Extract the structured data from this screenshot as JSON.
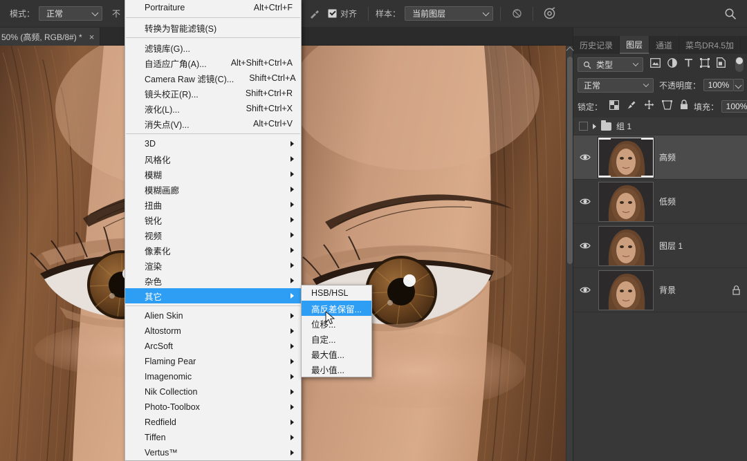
{
  "app": "Adobe Photoshop",
  "options_bar": {
    "mode_label": "模式：",
    "mode_value": "正常",
    "opacity_label_partial": "不",
    "aligned_label": "对齐",
    "sample_label": "样本：",
    "sample_value": "当前图层",
    "icons": [
      "brush-cursor-icon",
      "ignore-adjustment-layers-icon",
      "airbrush-target-icon"
    ],
    "search_icon": "search-icon"
  },
  "document_tab": {
    "title": "50% (高频, RGB/8#) *",
    "dirty_marker": "*",
    "close_icon": "×"
  },
  "filter_menu": {
    "groups": [
      {
        "items": [
          {
            "label": "Portraiture",
            "shortcut": "Alt+Ctrl+F",
            "submenu": false
          }
        ]
      },
      {
        "items": [
          {
            "label": "转换为智能滤镜(S)",
            "shortcut": "",
            "submenu": false
          }
        ]
      },
      {
        "items": [
          {
            "label": "滤镜库(G)...",
            "shortcut": "",
            "submenu": false
          },
          {
            "label": "自适应广角(A)...",
            "shortcut": "Alt+Shift+Ctrl+A",
            "submenu": false
          },
          {
            "label": "Camera Raw 滤镜(C)...",
            "shortcut": "Shift+Ctrl+A",
            "submenu": false
          },
          {
            "label": "镜头校正(R)...",
            "shortcut": "Shift+Ctrl+R",
            "submenu": false
          },
          {
            "label": "液化(L)...",
            "shortcut": "Shift+Ctrl+X",
            "submenu": false
          },
          {
            "label": "消失点(V)...",
            "shortcut": "Alt+Ctrl+V",
            "submenu": false
          }
        ]
      },
      {
        "items": [
          {
            "label": "3D",
            "shortcut": "",
            "submenu": true
          },
          {
            "label": "风格化",
            "shortcut": "",
            "submenu": true
          },
          {
            "label": "模糊",
            "shortcut": "",
            "submenu": true
          },
          {
            "label": "模糊画廊",
            "shortcut": "",
            "submenu": true
          },
          {
            "label": "扭曲",
            "shortcut": "",
            "submenu": true
          },
          {
            "label": "锐化",
            "shortcut": "",
            "submenu": true
          },
          {
            "label": "视频",
            "shortcut": "",
            "submenu": true
          },
          {
            "label": "像素化",
            "shortcut": "",
            "submenu": true
          },
          {
            "label": "渲染",
            "shortcut": "",
            "submenu": true
          },
          {
            "label": "杂色",
            "shortcut": "",
            "submenu": true
          },
          {
            "label": "其它",
            "shortcut": "",
            "submenu": true,
            "highlighted": true
          }
        ]
      },
      {
        "items": [
          {
            "label": "Alien Skin",
            "shortcut": "",
            "submenu": true
          },
          {
            "label": "Altostorm",
            "shortcut": "",
            "submenu": true
          },
          {
            "label": "ArcSoft",
            "shortcut": "",
            "submenu": true
          },
          {
            "label": "Flaming Pear",
            "shortcut": "",
            "submenu": true
          },
          {
            "label": "Imagenomic",
            "shortcut": "",
            "submenu": true
          },
          {
            "label": "Nik Collection",
            "shortcut": "",
            "submenu": true
          },
          {
            "label": "Photo-Toolbox",
            "shortcut": "",
            "submenu": true
          },
          {
            "label": "Redfield",
            "shortcut": "",
            "submenu": true
          },
          {
            "label": "Tiffen",
            "shortcut": "",
            "submenu": true
          },
          {
            "label": "Vertus™",
            "shortcut": "",
            "submenu": true
          }
        ]
      }
    ]
  },
  "other_submenu": {
    "items": [
      {
        "label": "HSB/HSL",
        "highlighted": false
      },
      {
        "label": "高反差保留...",
        "highlighted": true
      },
      {
        "label": "位移...",
        "highlighted": false
      },
      {
        "label": "自定...",
        "highlighted": false
      },
      {
        "label": "最大值...",
        "highlighted": false
      },
      {
        "label": "最小值...",
        "highlighted": false
      }
    ]
  },
  "right_panel": {
    "tabs": [
      {
        "label": "历史记录",
        "active": false
      },
      {
        "label": "图层",
        "active": true
      },
      {
        "label": "通道",
        "active": false
      },
      {
        "label": "菜鸟DR4.5加",
        "active": false
      }
    ],
    "panel_menu_icon": "hamburger-icon",
    "filter": {
      "kind_value": "类型",
      "search_icon": "search-icon",
      "icons": [
        "pixel-layer-filter-icon",
        "adjustment-layer-filter-icon",
        "type-layer-filter-icon",
        "shape-layer-filter-icon",
        "smart-object-filter-icon"
      ],
      "toggle": "filter-enable-toggle"
    },
    "blend": {
      "mode_value": "正常",
      "opacity_label": "不透明度：",
      "opacity_value": "100%"
    },
    "lock": {
      "label": "锁定：",
      "icons": [
        "lock-transparency-icon",
        "lock-image-icon",
        "lock-position-icon",
        "lock-artboard-icon",
        "lock-all-icon"
      ],
      "fill_label": "填充：",
      "fill_value": "100%"
    },
    "group": {
      "name": "组 1",
      "expand_icon": "chevron-right-icon",
      "folder_icon": "folder-icon"
    },
    "layers": [
      {
        "name": "高频",
        "visible": true,
        "selected": true,
        "locked": false,
        "thumb_selected": true
      },
      {
        "name": "低频",
        "visible": true,
        "selected": false,
        "locked": false,
        "thumb_selected": false
      },
      {
        "name": "图层 1",
        "visible": true,
        "selected": false,
        "locked": false,
        "thumb_selected": false
      },
      {
        "name": "背景",
        "visible": true,
        "selected": false,
        "locked": true,
        "thumb_selected": false
      }
    ]
  },
  "colors": {
    "highlight": "#2e9ef4",
    "menu_bg": "#f2f2f2",
    "panel_bg": "#333333",
    "layer_bg": "#383838",
    "layer_selected": "#4b4b4b"
  }
}
